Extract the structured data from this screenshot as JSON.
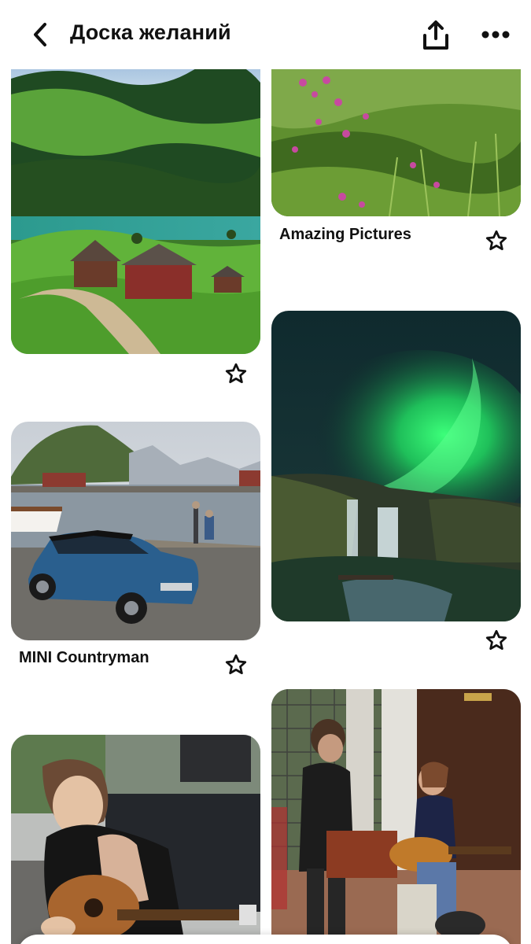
{
  "header": {
    "title": "Доска желаний",
    "back_icon": "chevron-left-icon",
    "share_icon": "share-icon",
    "more_icon": "more-horizontal-icon"
  },
  "pins": [
    {
      "id": "alpine-village",
      "title": "",
      "image": "alpine village by a lake with green hills"
    },
    {
      "id": "flowers-meadow",
      "title": "Amazing Pictures",
      "image": "pink wildflowers on a green grassy slope"
    },
    {
      "id": "aurora-waterfall",
      "title": "",
      "image": "green aurora over a waterfall at night"
    },
    {
      "id": "mini-countryman",
      "title": "MINI Countryman",
      "image": "blue MINI Countryman parked by a harbor with mountains"
    },
    {
      "id": "guitar-girl",
      "title": "",
      "image": "young woman playing acoustic guitar"
    },
    {
      "id": "street-musicians",
      "title": "",
      "image": "man and woman playing guitar on a street"
    }
  ],
  "colors": {
    "header_bg": "#ffffff",
    "text": "#111111",
    "icon": "#111111"
  }
}
